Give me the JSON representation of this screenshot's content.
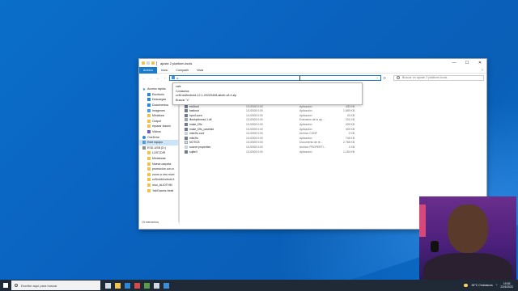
{
  "window": {
    "title": "ajuste 2 platform-tools",
    "minimize": "—",
    "maximize": "☐",
    "close": "✕",
    "ribbon_tabs": [
      "Archivo",
      "Inicio",
      "Compartir",
      "Vista"
    ],
    "help": "?",
    "address": "c",
    "search_placeholder": "Buscar en ajuste 2 platform-tools",
    "status": "19 elementos"
  },
  "autocomplete": [
    "calc",
    "Contactos",
    "cvDroidAndroid-12.1-20220408-alioth-v8.4.zip",
    "Buscar \"c\""
  ],
  "nav": [
    {
      "label": "Acceso rápido",
      "icon": "star-icon",
      "cls": "star",
      "indent": false
    },
    {
      "label": "Escritorio",
      "icon": "desktop-icon",
      "cls": "blue",
      "indent": true
    },
    {
      "label": "Descargas",
      "icon": "download-icon",
      "cls": "dl",
      "indent": true
    },
    {
      "label": "Documentos",
      "icon": "documents-icon",
      "cls": "blue",
      "indent": true
    },
    {
      "label": "Imágenes",
      "icon": "pictures-icon",
      "cls": "img",
      "indent": true
    },
    {
      "label": "Miniatura",
      "icon": "folder-icon",
      "cls": "fold",
      "indent": true
    },
    {
      "label": "Output",
      "icon": "folder-icon",
      "cls": "fold",
      "indent": true
    },
    {
      "label": "reparar xiaomi",
      "icon": "folder-icon",
      "cls": "fold",
      "indent": true
    },
    {
      "label": "Videos",
      "icon": "videos-icon",
      "cls": "vid",
      "indent": true
    },
    {
      "label": "OneDrive",
      "icon": "cloud-icon",
      "cls": "cloud",
      "indent": false
    },
    {
      "label": "Este equipo",
      "icon": "computer-icon",
      "cls": "pc",
      "indent": false,
      "selected": true
    },
    {
      "label": "ESD-USB (D:)",
      "icon": "drive-icon",
      "cls": "drive",
      "indent": false
    },
    {
      "label": "LOST.DIR",
      "icon": "folder-icon",
      "cls": "fold",
      "indent": true
    },
    {
      "label": "Miniaturas",
      "icon": "folder-icon",
      "cls": "fold",
      "indent": true
    },
    {
      "label": "Nueva carpeta",
      "icon": "folder-icon",
      "cls": "fold",
      "indent": true
    },
    {
      "label": "promoción con a",
      "icon": "folder-icon",
      "cls": "fold",
      "indent": true
    },
    {
      "label": "zoom a otro nivel",
      "icon": "folder-icon",
      "cls": "fold",
      "indent": true
    },
    {
      "label": "cvDroidAndroid-1",
      "icon": "folder-icon",
      "cls": "fold",
      "indent": true
    },
    {
      "label": "miui_ALIOTHM",
      "icon": "folder-icon",
      "cls": "fold",
      "indent": true
    },
    {
      "label": "YakGaamz-besti",
      "icon": "folder-icon",
      "cls": "fold",
      "indent": true
    }
  ],
  "files": [
    {
      "name": "AdbWinUsbApi.dll",
      "date": "1/1/2008 0:00",
      "type": "Extensión de la ap...",
      "size": "72 KB",
      "icon": "dll"
    },
    {
      "name": "cvDroidAndroid-12.1-20220408-alioth-v8.4.zip",
      "date": "16/4/2022 23:50",
      "type": "Archivo WinRAR Z...",
      "size": "1.072.173 KB",
      "icon": "zip"
    },
    {
      "name": "dmtracedump",
      "date": "1/1/2008 0:00",
      "type": "Aplicación",
      "size": "237 KB",
      "icon": "exe"
    },
    {
      "name": "etc1tool",
      "date": "1/1/2008 0:00",
      "type": "Aplicación",
      "size": "430 KB",
      "icon": "exe"
    },
    {
      "name": "fastboot",
      "date": "1/1/2008 0:00",
      "type": "Aplicación",
      "size": "1.659 KB",
      "icon": "exe"
    },
    {
      "name": "hprof-conv",
      "date": "1/1/2008 0:00",
      "type": "Aplicación",
      "size": "43 KB",
      "icon": "exe"
    },
    {
      "name": "libwinpthread-1.dll",
      "date": "1/1/2008 0:00",
      "type": "Extensión de la ap...",
      "size": "231 KB",
      "icon": "dll"
    },
    {
      "name": "make_f2fs",
      "date": "1/1/2008 0:00",
      "type": "Aplicación",
      "size": "409 KB",
      "icon": "exe"
    },
    {
      "name": "make_f2fs_casefold",
      "date": "1/1/2008 0:00",
      "type": "Aplicación",
      "size": "409 KB",
      "icon": "exe"
    },
    {
      "name": "mke2fs.conf",
      "date": "1/1/2008 0:00",
      "type": "Archivo CONF",
      "size": "2 KB",
      "icon": "cf"
    },
    {
      "name": "mke2fs",
      "date": "1/1/2008 0:00",
      "type": "Aplicación",
      "size": "746 KB",
      "icon": "exe"
    },
    {
      "name": "NOTICE",
      "date": "1/1/2008 0:00",
      "type": "Documento de te...",
      "size": "2.768 KB",
      "icon": "txt"
    },
    {
      "name": "source.properties",
      "date": "1/1/2008 0:00",
      "type": "Archivo PROPERTI...",
      "size": "1 KB",
      "icon": "cf"
    },
    {
      "name": "sqlite3",
      "date": "1/1/2008 0:00",
      "type": "Aplicación",
      "size": "1.150 KB",
      "icon": "exe"
    }
  ],
  "taskbar": {
    "search_placeholder": "Escribe aquí para buscar",
    "weather": "26°C Chubascos",
    "time": "19:52",
    "date": "22/4/2022"
  }
}
